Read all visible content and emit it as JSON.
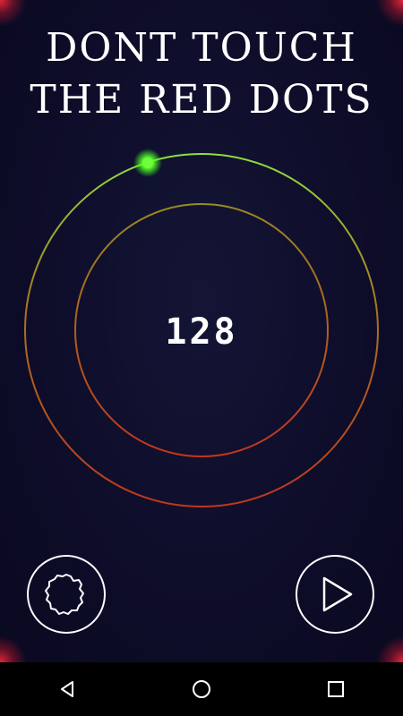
{
  "title": {
    "line1": "DONT TOUCH",
    "line2": "THE RED DOTS"
  },
  "score": "128",
  "colors": {
    "background": "#0b0a22",
    "ring_green": "#7fe03a",
    "ring_red": "#c2351c",
    "player_dot": "#6cff3a",
    "corner_glow": "#ff2a3c",
    "text": "#ffffff"
  },
  "buttons": {
    "settings_icon": "gear-icon",
    "play_icon": "play-icon"
  },
  "navbar": {
    "back_icon": "back-triangle-icon",
    "home_icon": "home-circle-icon",
    "recents_icon": "recents-square-icon"
  }
}
